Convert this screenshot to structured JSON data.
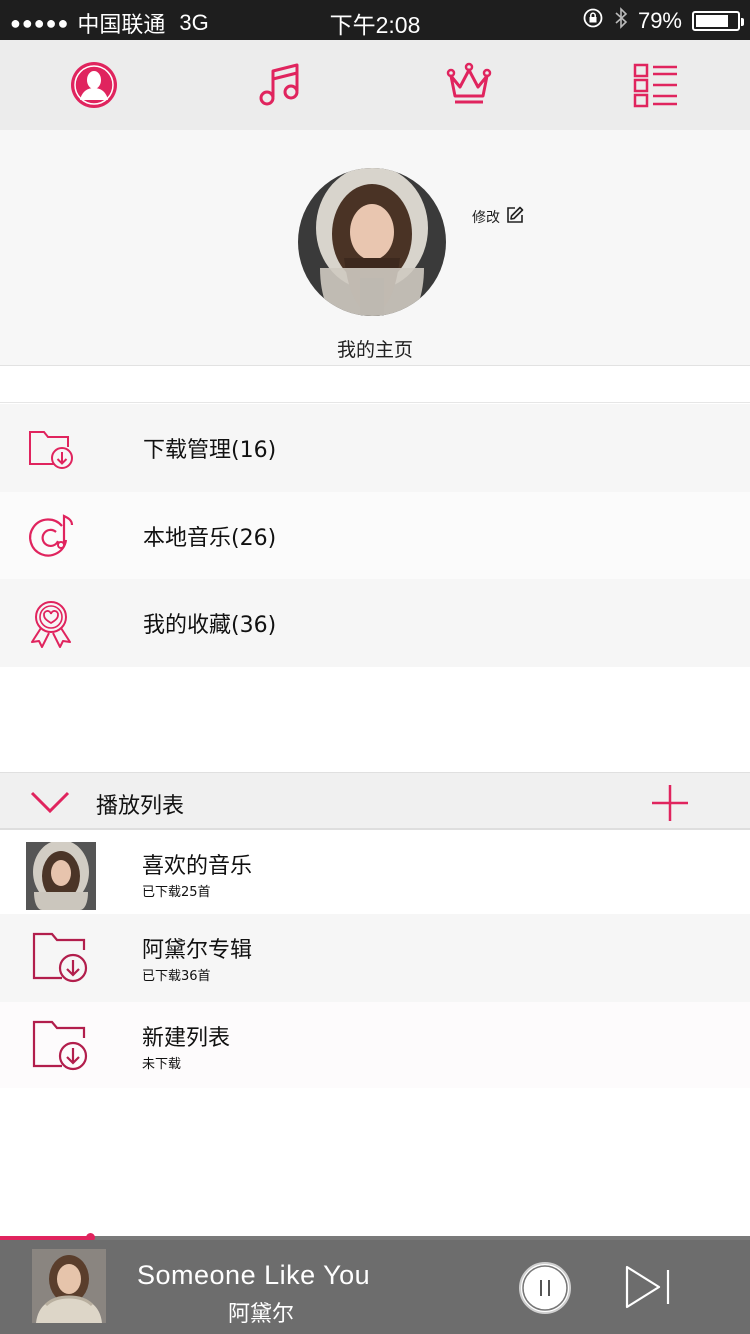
{
  "status_bar": {
    "signal": "●●●●●",
    "carrier": "中国联通",
    "network": "3G",
    "time": "下午2:08",
    "battery": "79%",
    "battery_level": 0.79
  },
  "top_tabs": [
    {
      "name": "profile",
      "icon": "person-icon",
      "active": true
    },
    {
      "name": "music",
      "icon": "music-note-icon",
      "active": false
    },
    {
      "name": "vip",
      "icon": "crown-icon",
      "active": false
    },
    {
      "name": "list",
      "icon": "list-icon",
      "active": false
    }
  ],
  "profile": {
    "edit_label": "修改",
    "name": "我的主页"
  },
  "menu": [
    {
      "label": "下载管理(16)",
      "icon": "folder-download-icon"
    },
    {
      "label": "本地音乐(26)",
      "icon": "disc-music-icon"
    },
    {
      "label": "我的收藏(36)",
      "icon": "heart-badge-icon"
    }
  ],
  "playlist_header": {
    "title": "播放列表"
  },
  "playlists": [
    {
      "name": "喜欢的音乐",
      "sub": "已下载25首",
      "icon": "album-thumbnail"
    },
    {
      "name": "阿黛尔专辑",
      "sub": "已下载36首",
      "icon": "folder-download-icon"
    },
    {
      "name": "新建列表",
      "sub": "未下载",
      "icon": "folder-download-icon"
    }
  ],
  "player": {
    "song": "Someone Like You",
    "artist": "阿黛尔",
    "progress": 0.12
  },
  "colors": {
    "accent": "#e0245e",
    "player_bg": "#6d6d6d"
  }
}
